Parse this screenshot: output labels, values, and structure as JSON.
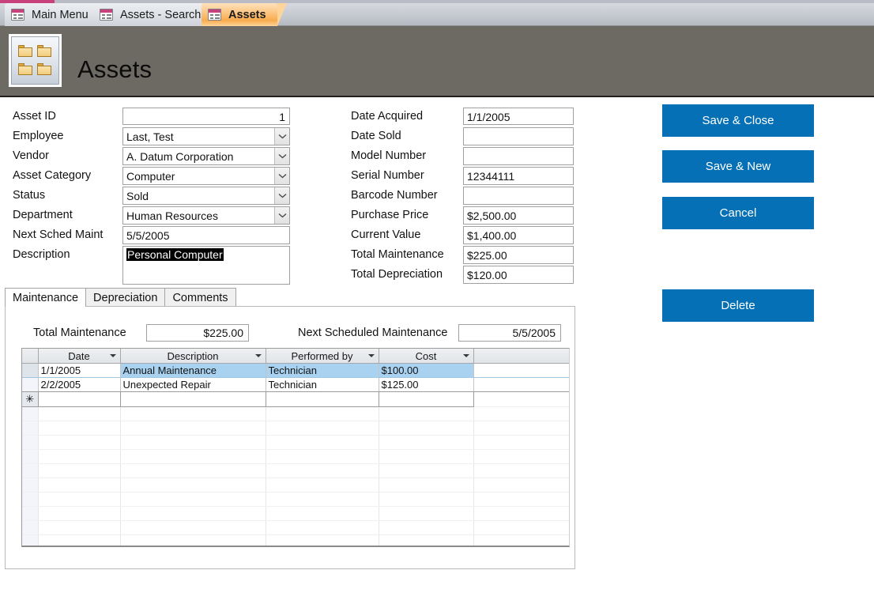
{
  "window": {
    "doc_tabs": [
      {
        "label": "Main Menu",
        "icon": "form-icon",
        "active": false
      },
      {
        "label": "Assets - Search",
        "icon": "form-icon",
        "active": false
      },
      {
        "label": "Assets",
        "icon": "form-icon",
        "active": true
      }
    ]
  },
  "header": {
    "title": "Assets",
    "logo_icon": "folders-grid-icon",
    "background_color": "#6d6a63"
  },
  "form": {
    "left_fields": [
      {
        "label": "Asset ID",
        "value": "1",
        "type": "text",
        "align": "right"
      },
      {
        "label": "Employee",
        "value": "Last, Test",
        "type": "combo"
      },
      {
        "label": "Vendor",
        "value": "A. Datum Corporation",
        "type": "combo"
      },
      {
        "label": "Asset Category",
        "value": "Computer",
        "type": "combo"
      },
      {
        "label": "Status",
        "value": "Sold",
        "type": "combo"
      },
      {
        "label": "Department",
        "value": "Human Resources",
        "type": "combo"
      },
      {
        "label": "Next Sched Maint",
        "value": "5/5/2005",
        "type": "text"
      },
      {
        "label": "Description",
        "value": "Personal Computer",
        "type": "memo",
        "selected": true
      }
    ],
    "right_fields": [
      {
        "label": "Date Acquired",
        "value": "1/1/2005"
      },
      {
        "label": "Date Sold",
        "value": ""
      },
      {
        "label": "Model Number",
        "value": ""
      },
      {
        "label": "Serial Number",
        "value": "12344111"
      },
      {
        "label": "Barcode Number",
        "value": ""
      },
      {
        "label": "Purchase Price",
        "value": "$2,500.00"
      },
      {
        "label": "Current Value",
        "value": "$1,400.00"
      },
      {
        "label": "Total Maintenance",
        "value": "$225.00"
      },
      {
        "label": "Total Depreciation",
        "value": "$120.00"
      }
    ],
    "buttons": [
      {
        "label": "Save & Close",
        "color": "#0570b6"
      },
      {
        "label": "Save & New",
        "color": "#0570b6"
      },
      {
        "label": "Cancel",
        "color": "#0570b6"
      },
      {
        "label": "Delete",
        "color": "#0570b6"
      }
    ]
  },
  "tab_control": {
    "tabs": [
      {
        "label": "Maintenance",
        "active": true
      },
      {
        "label": "Depreciation",
        "active": false
      },
      {
        "label": "Comments",
        "active": false
      }
    ],
    "summary": {
      "total_maintenance_label": "Total Maintenance",
      "total_maintenance_value": "$225.00",
      "next_sched_label": "Next Scheduled Maintenance",
      "next_sched_value": "5/5/2005"
    },
    "datasheet": {
      "columns": [
        "Date",
        "Description",
        "Performed by",
        "Cost"
      ],
      "rows": [
        {
          "date": "1/1/2005",
          "description": "Annual Maintenance",
          "performed_by": "Technician",
          "cost": "$100.00",
          "selected": true
        },
        {
          "date": "2/2/2005",
          "description": "Unexpected Repair",
          "performed_by": "Technician",
          "cost": "$125.00",
          "selected": false
        }
      ],
      "new_row_marker": "✳",
      "selection_color": "#a8d2f0"
    }
  }
}
